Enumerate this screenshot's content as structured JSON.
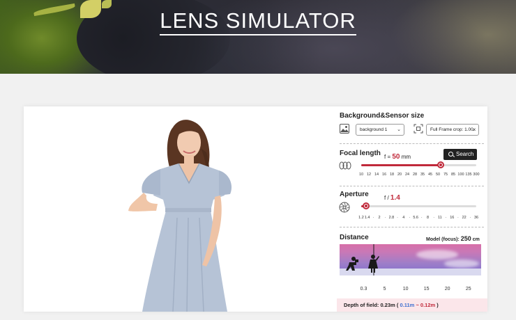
{
  "header": {
    "title": "LENS SIMULATOR"
  },
  "panel": {
    "background_sensor": {
      "title": "Background&Sensor size",
      "background_select": "background 1",
      "sensor_select": "Full Frame crop: 1.00x"
    },
    "focal_length": {
      "title": "Focal length",
      "prefix": "f =",
      "value": "50",
      "unit": "mm",
      "search_label": "Search",
      "ticks": [
        "10",
        "12",
        "14",
        "16",
        "18",
        "20",
        "24",
        "28",
        "35",
        "45",
        "50",
        "75",
        "85",
        "100",
        "135",
        "300"
      ],
      "slider_fraction": 0.69
    },
    "aperture": {
      "title": "Aperture",
      "prefix": "f /",
      "value": "1.4",
      "ticks": [
        "1.2",
        "1.4",
        "·",
        "2",
        "·",
        "2.8",
        "·",
        "4",
        "·",
        "5.6",
        "·",
        "8",
        "·",
        "11",
        "·",
        "16",
        "·",
        "22",
        "·",
        "36"
      ],
      "slider_fraction": 0.04
    },
    "distance": {
      "title": "Distance",
      "model_label": "Model (focus):",
      "value": "250",
      "unit": "cm",
      "ticks": [
        "0.3",
        "5",
        "10",
        "15",
        "20",
        "25"
      ]
    },
    "depth_of_field": {
      "label": "Depth of field:",
      "total": "0.23m",
      "open": "(",
      "near": "0.11m",
      "sep": "~",
      "far": "0.12m",
      "close": ")"
    }
  },
  "colors": {
    "accent": "#c0293a",
    "near": "#3d6fd0",
    "dress": "#b6c3d6"
  }
}
